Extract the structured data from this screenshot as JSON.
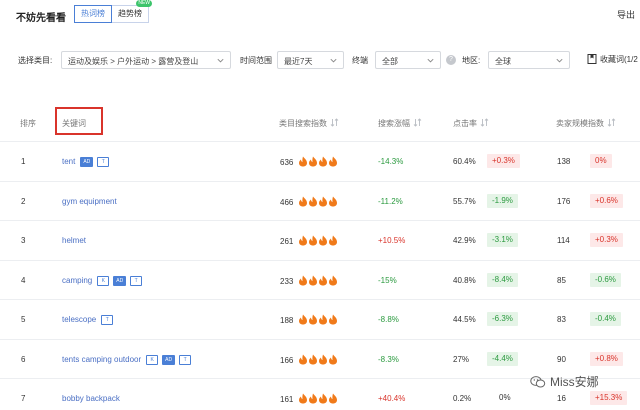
{
  "header": {
    "title": "不妨先看看",
    "tabs": [
      {
        "label": "热词榜",
        "active": true
      },
      {
        "label": "趋势榜",
        "active": false,
        "badge": "NEW"
      }
    ],
    "export_label": "导出"
  },
  "filters": {
    "category_label": "选择类目:",
    "category_value": "运动及娱乐 > 户外运动 > 露营及登山",
    "time_label": "时间范围",
    "time_value": "最近7天",
    "device_label": "终端",
    "device_value": "全部",
    "region_label": "地区:",
    "region_value": "全球",
    "favorites_label": "收藏词(1/2"
  },
  "table": {
    "headers": {
      "rank": "排序",
      "keyword": "关键词",
      "search_index": "类目搜索指数",
      "search_growth": "搜索涨幅",
      "ctr": "点击率",
      "seller_index": "卖家规模指数"
    },
    "rows": [
      {
        "rank": "1",
        "keyword": "tent",
        "tags": [
          "AD",
          "T"
        ],
        "index": "636",
        "flames": 4,
        "growth": "-14.3%",
        "growth_dir": "down",
        "ctr": "60.4%",
        "ctr_change": "+0.3%",
        "ctr_dir": "up",
        "seller": "138",
        "seller_change": "0%",
        "seller_dir": "up"
      },
      {
        "rank": "2",
        "keyword": "gym equipment",
        "tags": [],
        "index": "466",
        "flames": 4,
        "growth": "-11.2%",
        "growth_dir": "down",
        "ctr": "55.7%",
        "ctr_change": "-1.9%",
        "ctr_dir": "down",
        "seller": "176",
        "seller_change": "+0.6%",
        "seller_dir": "up"
      },
      {
        "rank": "3",
        "keyword": "helmet",
        "tags": [],
        "index": "261",
        "flames": 4,
        "growth": "+10.5%",
        "growth_dir": "up",
        "ctr": "42.9%",
        "ctr_change": "-3.1%",
        "ctr_dir": "down",
        "seller": "114",
        "seller_change": "+0.3%",
        "seller_dir": "up"
      },
      {
        "rank": "4",
        "keyword": "camping",
        "tags": [
          "K",
          "AD",
          "T"
        ],
        "index": "233",
        "flames": 4,
        "growth": "-15%",
        "growth_dir": "down",
        "ctr": "40.8%",
        "ctr_change": "-8.4%",
        "ctr_dir": "down",
        "seller": "85",
        "seller_change": "-0.6%",
        "seller_dir": "down"
      },
      {
        "rank": "5",
        "keyword": "telescope",
        "tags": [
          "T"
        ],
        "index": "188",
        "flames": 4,
        "growth": "-8.8%",
        "growth_dir": "down",
        "ctr": "44.5%",
        "ctr_change": "-6.3%",
        "ctr_dir": "down",
        "seller": "83",
        "seller_change": "-0.4%",
        "seller_dir": "down"
      },
      {
        "rank": "6",
        "keyword": "tents camping outdoor",
        "tags": [
          "K",
          "AD",
          "T"
        ],
        "index": "166",
        "flames": 4,
        "growth": "-8.3%",
        "growth_dir": "down",
        "ctr": "27%",
        "ctr_change": "-4.4%",
        "ctr_dir": "down",
        "seller": "90",
        "seller_change": "+0.8%",
        "seller_dir": "up"
      },
      {
        "rank": "7",
        "keyword": "bobby backpack",
        "tags": [],
        "index": "161",
        "flames": 4,
        "growth": "+40.4%",
        "growth_dir": "up",
        "ctr": "0.2%",
        "ctr_change": "0%",
        "ctr_dir": "flat",
        "seller": "16",
        "seller_change": "+15.3%",
        "seller_dir": "up"
      }
    ]
  },
  "watermark": "Miss安娜",
  "colors": {
    "accent": "#4a7fd6",
    "keyword": "#4a6fc4",
    "down": "#2b9a3f",
    "up": "#d9342b",
    "flame": "#f07a1a",
    "highlight_box": "#d9342b"
  }
}
